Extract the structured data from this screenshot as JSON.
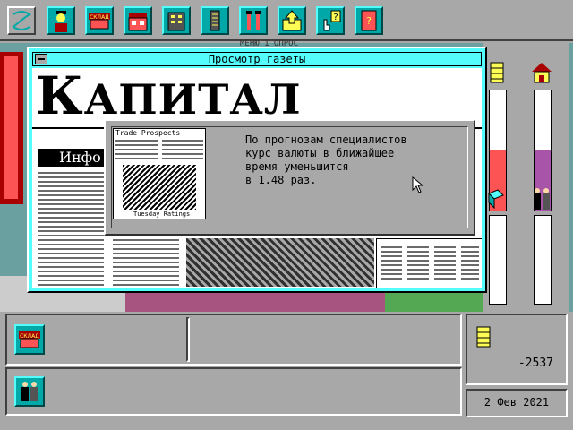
{
  "window": {
    "title": "Просмотр газеты",
    "background_title": "МЕНЮ 1 ОПРОС"
  },
  "newspaper": {
    "masthead_first": "К",
    "masthead_rest": "АПИТАЛ",
    "section_heading": "Инфо"
  },
  "popup": {
    "message": "По прогнозам специалистов\nкурс валюты в ближайшее\nвремя уменьшится\nв 1.48 раз.",
    "thumb_title": "Trade Prospects",
    "thumb_caption": "Tuesday Ratings"
  },
  "toolbar": {
    "buttons": [
      {
        "name": "mode-icon"
      },
      {
        "name": "boss-portrait-icon"
      },
      {
        "name": "warehouse-icon",
        "label": "СКЛАД"
      },
      {
        "name": "shop-icon"
      },
      {
        "name": "office-building-icon"
      },
      {
        "name": "skyscraper-icon"
      },
      {
        "name": "tools-icon"
      },
      {
        "name": "export-icon"
      },
      {
        "name": "help-icon"
      },
      {
        "name": "notebook-icon"
      }
    ]
  },
  "gauges": {
    "left_level": 0.5,
    "right_level": 0.5,
    "left_color": "#fc5454",
    "right_color": "#a854a8"
  },
  "status": {
    "warehouse_label": "СКЛАД",
    "balance": "-2537",
    "date": "2 Фев 2021"
  },
  "colors": {
    "accent": "#00a8a8",
    "window": "#54fcfc",
    "panel": "#a8a8a8"
  }
}
